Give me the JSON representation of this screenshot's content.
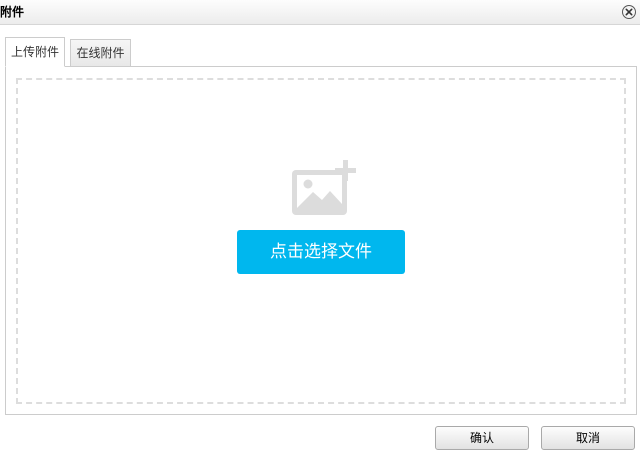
{
  "dialog": {
    "title": "附件"
  },
  "tabs": [
    {
      "label": "上传附件",
      "active": true
    },
    {
      "label": "在线附件",
      "active": false
    }
  ],
  "upload": {
    "pick_button_label": "点击选择文件",
    "icon": "image-add-icon"
  },
  "footer": {
    "ok_label": "确认",
    "cancel_label": "取消"
  },
  "colors": {
    "accent": "#00b7ee",
    "dashed_border": "#dddddd",
    "icon_gray": "#dcdcdc"
  }
}
